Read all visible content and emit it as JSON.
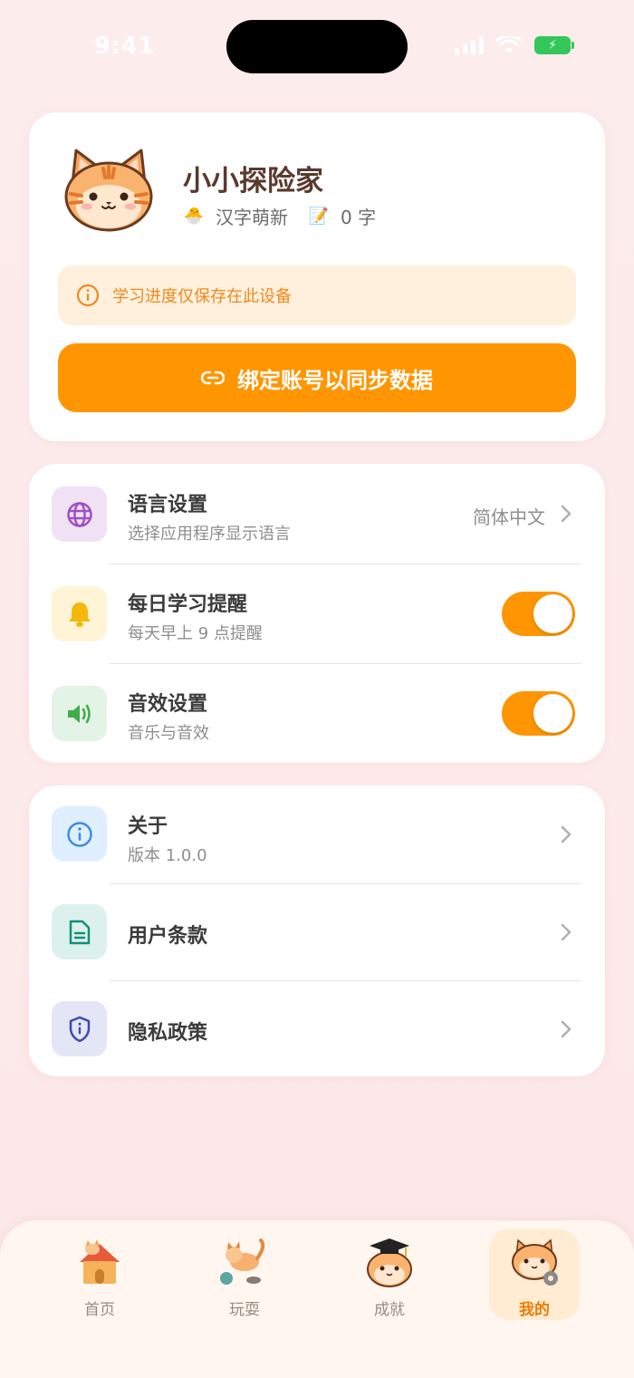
{
  "status": {
    "time": "9:41"
  },
  "profile": {
    "name": "小小探险家",
    "level": "汉字萌新",
    "char_count": "0 字",
    "notice": "学习进度仅保存在此设备",
    "bind_label": "绑定账号以同步数据"
  },
  "settings": [
    {
      "title": "语言设置",
      "subtitle": "选择应用程序显示语言",
      "value": "简体中文",
      "icon": "globe-icon"
    },
    {
      "title": "每日学习提醒",
      "subtitle": "每天早上 9 点提醒",
      "toggle_on": true,
      "icon": "bell-icon"
    },
    {
      "title": "音效设置",
      "subtitle": "音乐与音效",
      "toggle_on": true,
      "icon": "speaker-icon"
    }
  ],
  "info": [
    {
      "title": "关于",
      "subtitle": "版本 1.0.0",
      "icon": "info-icon"
    },
    {
      "title": "用户条款",
      "icon": "document-icon"
    },
    {
      "title": "隐私政策",
      "icon": "shield-icon"
    }
  ],
  "tabs": [
    {
      "label": "首页",
      "icon": "cat-house-icon"
    },
    {
      "label": "玩耍",
      "icon": "cat-playing-icon"
    },
    {
      "label": "成就",
      "icon": "cat-graduate-icon"
    },
    {
      "label": "我的",
      "icon": "cat-settings-icon",
      "active": true
    }
  ],
  "colors": {
    "accent": "#ff9500",
    "notice_bg": "#fef0dd",
    "notice_text": "#f08a1d",
    "background": "#fdecec"
  }
}
